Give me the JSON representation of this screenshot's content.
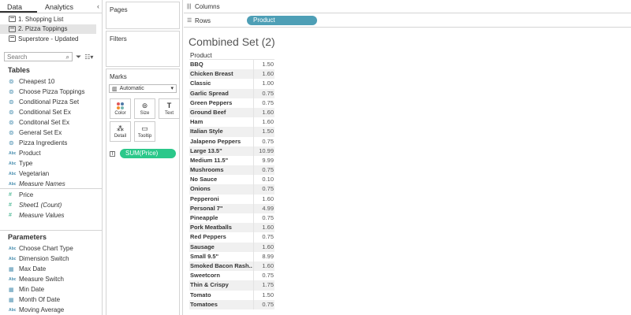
{
  "data_pane": {
    "tabs": [
      {
        "label": "Data"
      },
      {
        "label": "Analytics"
      }
    ],
    "collapse_glyph": "‹",
    "datasources": [
      {
        "label": "1. Shopping List",
        "selected": false
      },
      {
        "label": "2. Pizza Toppings",
        "selected": true
      },
      {
        "label": "Superstore - Updated",
        "selected": false
      }
    ],
    "search_placeholder": "Search",
    "tables_heading": "Tables",
    "fields": [
      {
        "label": "Cheapest 10",
        "icon": "set-icon",
        "italic": false
      },
      {
        "label": "Choose Pizza Toppings",
        "icon": "set-icon",
        "italic": false
      },
      {
        "label": "Conditional Pizza Set",
        "icon": "set-icon",
        "italic": false
      },
      {
        "label": "Conditional Set Ex",
        "icon": "set-icon",
        "italic": false
      },
      {
        "label": "Conditonal Set Ex",
        "icon": "set-icon",
        "italic": false
      },
      {
        "label": "General Set Ex",
        "icon": "set-icon",
        "italic": false
      },
      {
        "label": "Pizza Ingredients",
        "icon": "set-icon",
        "italic": false
      },
      {
        "label": "Product",
        "icon": "abc-icon",
        "italic": false
      },
      {
        "label": "Type",
        "icon": "abc-icon",
        "italic": false
      },
      {
        "label": "Vegetarian",
        "icon": "abc-icon",
        "italic": false
      },
      {
        "label": "Measure Names",
        "icon": "abc-icon",
        "italic": true
      }
    ],
    "measures": [
      {
        "label": "Price",
        "icon": "number-icon",
        "italic": false
      },
      {
        "label": "Sheet1 (Count)",
        "icon": "number-icon",
        "italic": true
      },
      {
        "label": "Measure Values",
        "icon": "number-icon",
        "italic": true
      }
    ],
    "parameters_heading": "Parameters",
    "parameters": [
      {
        "label": "Choose Chart Type",
        "icon": "abc-icon"
      },
      {
        "label": "Dimension Switch",
        "icon": "abc-icon"
      },
      {
        "label": "Max Date",
        "icon": "calendar-icon"
      },
      {
        "label": "Measure Switch",
        "icon": "abc-icon"
      },
      {
        "label": "Min Date",
        "icon": "calendar-icon"
      },
      {
        "label": "Month Of Date",
        "icon": "calendar-icon"
      },
      {
        "label": "Moving Average",
        "icon": "abc-icon"
      }
    ]
  },
  "shelves": {
    "pages_label": "Pages",
    "filters_label": "Filters",
    "marks_label": "Marks",
    "mark_type": "Automatic",
    "mark_buttons": {
      "color": "Color",
      "size": "Size",
      "text": "Text",
      "detail": "Detail",
      "tooltip": "Tooltip"
    },
    "text_pill": "SUM(Price)"
  },
  "view": {
    "columns_label": "Columns",
    "rows_label": "Rows",
    "rows_pill": "Product",
    "sheet_title": "Combined Set (2)",
    "table_header": "Product",
    "rows": [
      {
        "product": "BBQ",
        "price": "1.50"
      },
      {
        "product": "Chicken Breast",
        "price": "1.60"
      },
      {
        "product": "Classic",
        "price": "1.00"
      },
      {
        "product": "Garlic Spread",
        "price": "0.75"
      },
      {
        "product": "Green Peppers",
        "price": "0.75"
      },
      {
        "product": "Ground Beef",
        "price": "1.60"
      },
      {
        "product": "Ham",
        "price": "1.60"
      },
      {
        "product": "Italian Style",
        "price": "1.50"
      },
      {
        "product": "Jalapeno Peppers",
        "price": "0.75"
      },
      {
        "product": "Large 13.5\"",
        "price": "10.99"
      },
      {
        "product": "Medium 11.5\"",
        "price": "9.99"
      },
      {
        "product": "Mushrooms",
        "price": "0.75"
      },
      {
        "product": "No Sauce",
        "price": "0.10"
      },
      {
        "product": "Onions",
        "price": "0.75"
      },
      {
        "product": "Pepperoni",
        "price": "1.60"
      },
      {
        "product": "Personal 7\"",
        "price": "4.99"
      },
      {
        "product": "Pineapple",
        "price": "0.75"
      },
      {
        "product": "Pork Meatballs",
        "price": "1.60"
      },
      {
        "product": "Red Peppers",
        "price": "0.75"
      },
      {
        "product": "Sausage",
        "price": "1.60"
      },
      {
        "product": "Small 9.5\"",
        "price": "8.99"
      },
      {
        "product": "Smoked Bacon Rash..",
        "price": "1.60"
      },
      {
        "product": "Sweetcorn",
        "price": "0.75"
      },
      {
        "product": "Thin & Crispy",
        "price": "1.75"
      },
      {
        "product": "Tomato",
        "price": "1.50"
      },
      {
        "product": "Tomatoes",
        "price": "0.75"
      }
    ]
  },
  "colors": {
    "rows_pill": "#4e9fb6",
    "measure_pill": "#2bc88a"
  }
}
